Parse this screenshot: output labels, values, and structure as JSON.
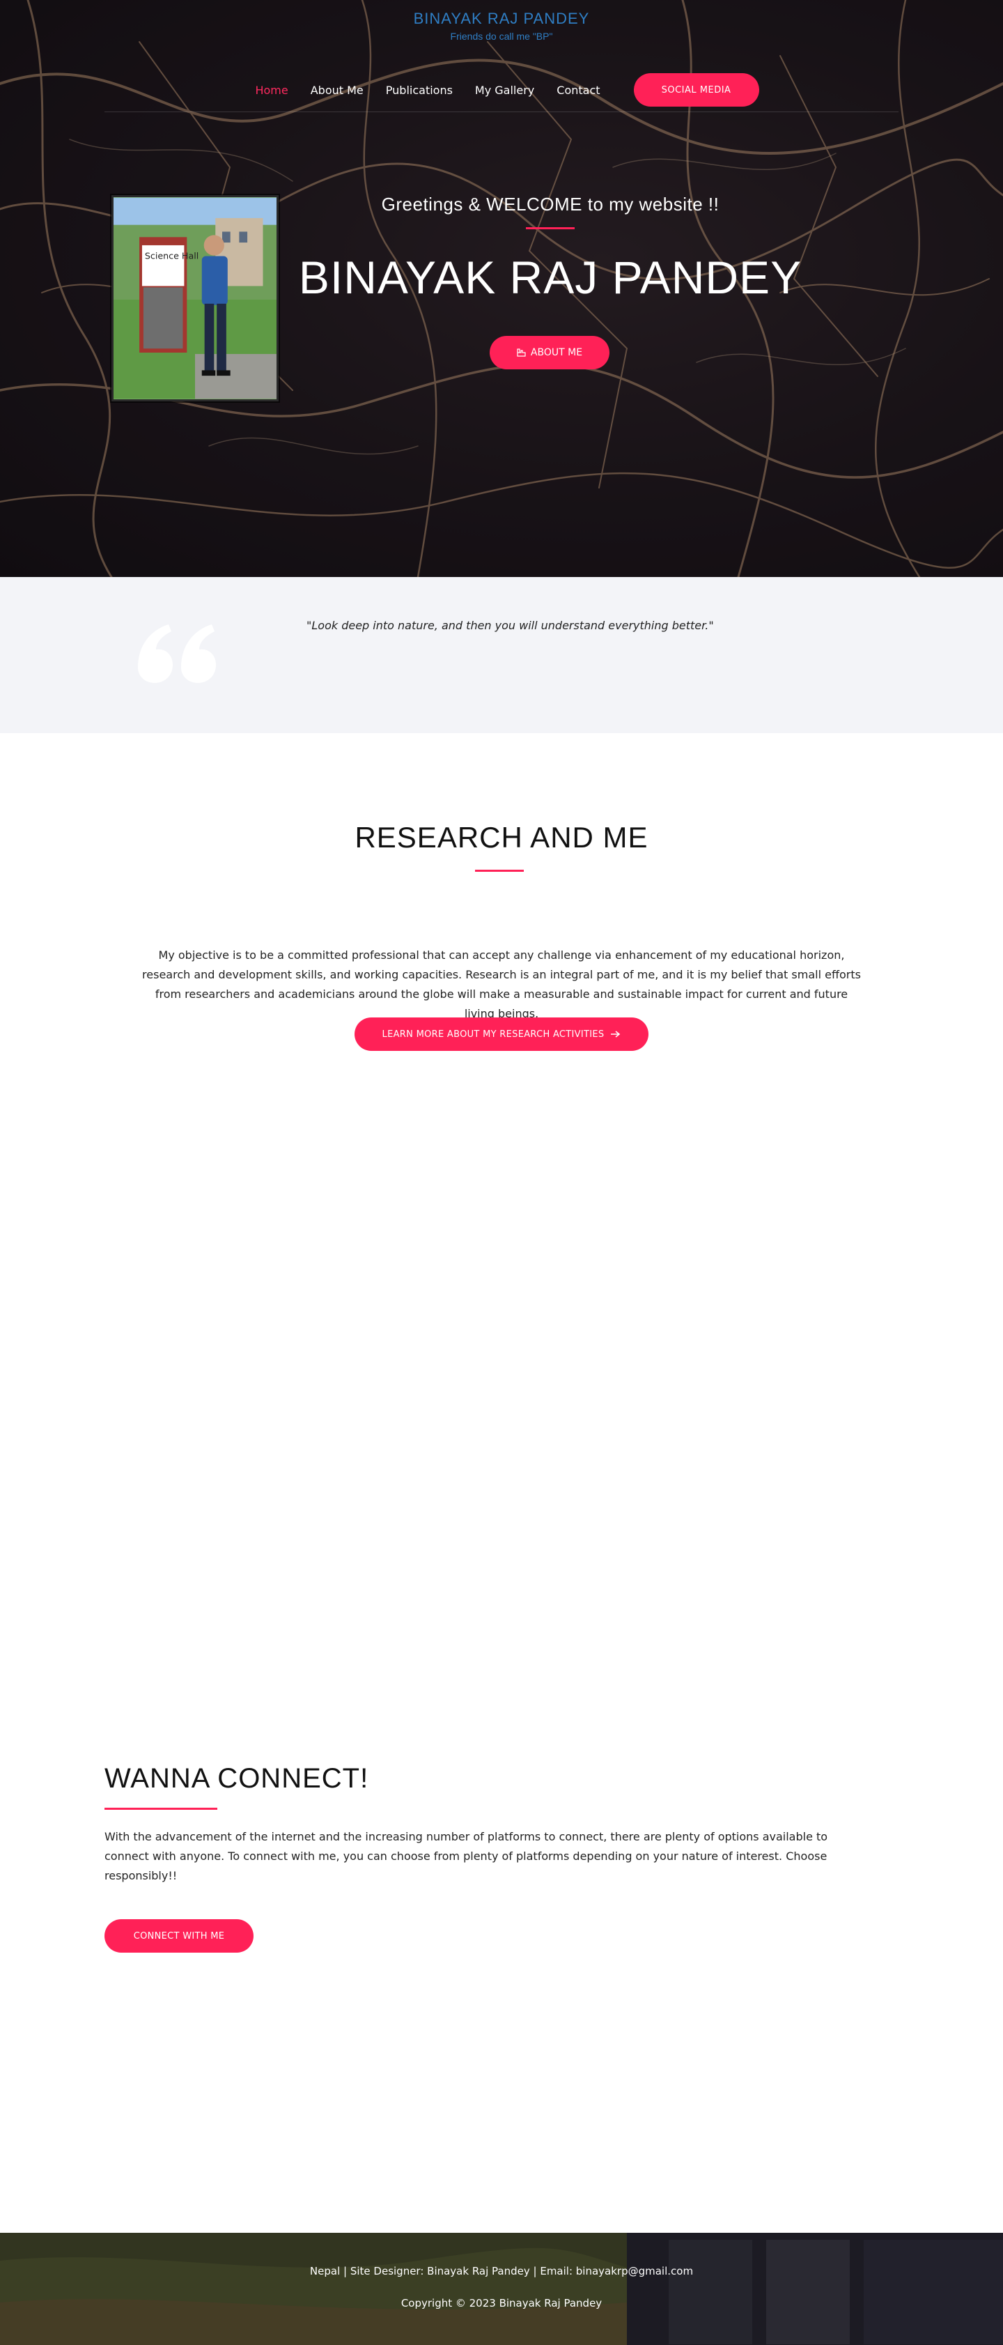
{
  "brand": {
    "title": "BINAYAK RAJ PANDEY",
    "tagline": "Friends do call me \"BP\""
  },
  "nav": {
    "items": [
      {
        "label": "Home",
        "active": true
      },
      {
        "label": "About Me",
        "active": false
      },
      {
        "label": "Publications",
        "active": false
      },
      {
        "label": "My Gallery",
        "active": false
      },
      {
        "label": "Contact",
        "active": false
      }
    ],
    "cta_label": "SOCIAL MEDIA"
  },
  "hero": {
    "greeting": "Greetings & WELCOME to my website !!",
    "name": "BINAYAK RAJ PANDEY",
    "about_button": "ABOUT ME",
    "about_icon": "hand-pointer-icon",
    "portrait_sign": "Science Hall"
  },
  "quote": {
    "icon": "quote-mark-icon",
    "text": "\"Look deep into nature, and then you will understand everything better.\""
  },
  "research": {
    "title": "RESEARCH AND ME",
    "text": "My objective is to be a committed professional that can accept any challenge via enhancement of my educational horizon, research and development skills, and working capacities. Research is an integral part of me, and it is my belief that small efforts from researchers and academicians around the globe will make a measurable and sustainable impact for current and future living beings.",
    "button": "LEARN MORE ABOUT MY RESEARCH ACTIVITIES",
    "button_icon": "arrow-right-icon"
  },
  "connect": {
    "title": "WANNA CONNECT!",
    "text": "With the advancement of the internet and the increasing number of platforms to connect, there are plenty of options available to connect with anyone. To connect with me, you can choose from plenty of platforms depending on your nature of interest. Choose responsibly!!",
    "button": "CONNECT WITH ME"
  },
  "footer": {
    "line1": "Nepal | Site Designer: Binayak Raj Pandey | Email: binayakrp@gmail.com",
    "line2": "Copyright © 2023 Binayak Raj Pandey"
  },
  "colors": {
    "accent": "#ff2157",
    "brand": "#2f7ec4",
    "quote_bg": "#f3f4f8"
  }
}
